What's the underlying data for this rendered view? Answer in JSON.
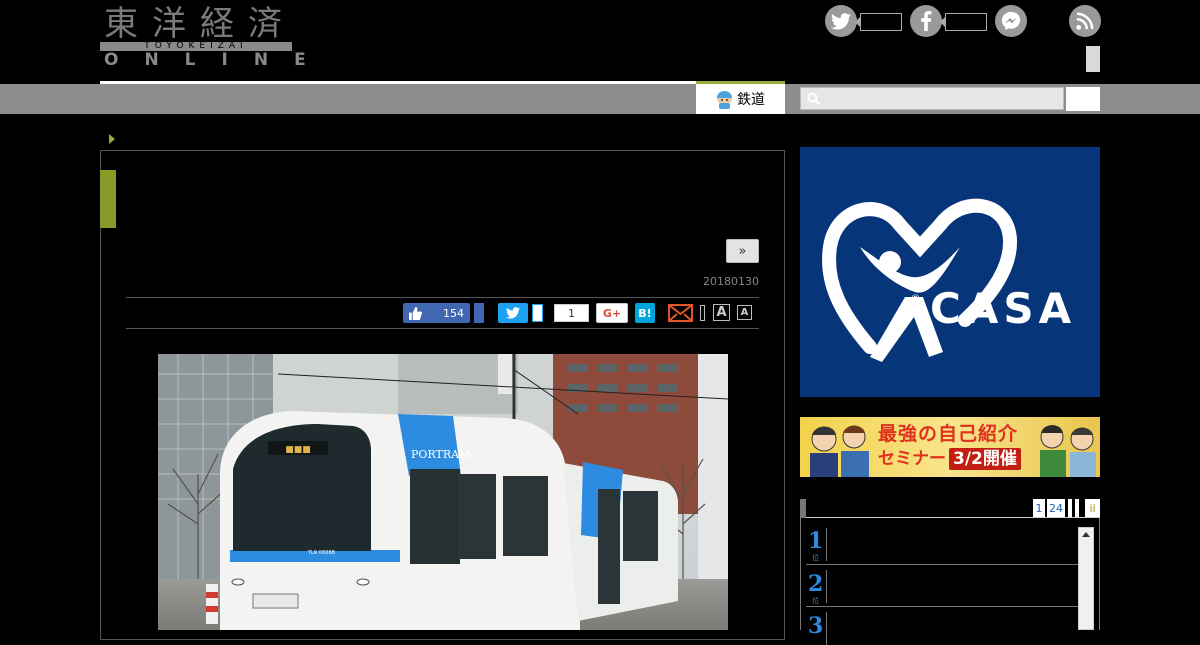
{
  "header": {
    "logo_kanji": "東洋経済",
    "logo_band": "TOYOKEIZAI",
    "logo_online": "ONLINE"
  },
  "social": {
    "twitter_icon": "twitter-bird-icon",
    "facebook_icon": "facebook-f-icon",
    "messenger_icon": "messenger-icon",
    "rss_icon": "rss-icon"
  },
  "nav": {
    "category_tab": "鉄道",
    "search_icon": "magnifier-icon"
  },
  "article": {
    "next_label": "»",
    "date": "20180130"
  },
  "share": {
    "like_count": "154",
    "share_count": "1",
    "gplus_label": "G+",
    "hatena_label": "B!",
    "font_large_label": "A",
    "font_small_label": "A"
  },
  "photo": {
    "sign_text": "PORTRAM",
    "car_number": "TLR 0606B"
  },
  "ads": {
    "casa_brand": "CASA",
    "casa_registered": "®",
    "seminar_title": "最強の自己紹介",
    "seminar_sub": "セミナー",
    "seminar_date": "3/2開催"
  },
  "ranking": {
    "tabs": [
      "1",
      "24",
      "",
      "",
      "ii"
    ],
    "numbers": [
      "1",
      "2",
      "3"
    ],
    "rank_suffix": "位"
  },
  "colors": {
    "accent_green": "#8a9a28",
    "nav_gray": "#8c8c8c",
    "casa_blue": "#06357a",
    "facebook_blue": "#4267b2",
    "twitter_blue": "#1da1f2",
    "rank_blue": "#2d8ce0"
  }
}
